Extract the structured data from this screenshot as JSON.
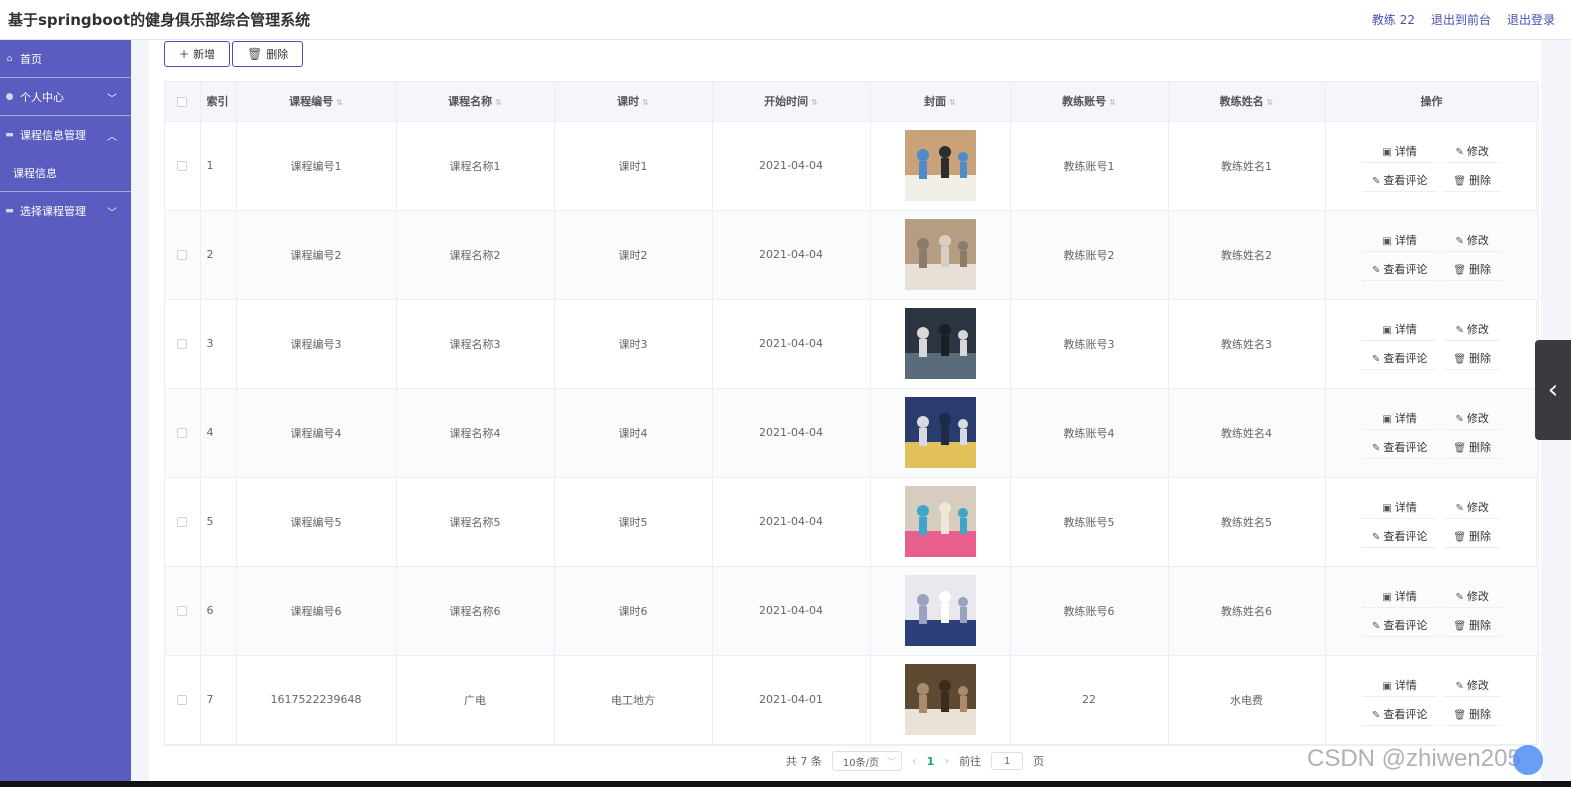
{
  "header": {
    "title": "基于springboot的健身俱乐部综合管理系统",
    "user_label": "教练 22",
    "back_front": "退出到前台",
    "logout": "退出登录"
  },
  "sidebar": {
    "items": [
      {
        "label": "首页",
        "icon": "home-icon",
        "chevron": ""
      },
      {
        "label": "个人中心",
        "icon": "user-icon",
        "chevron": "﹀"
      },
      {
        "label": "课程信息管理",
        "icon": "folder-icon",
        "chevron": "︿"
      },
      {
        "label": "课程信息",
        "icon": "",
        "chevron": ""
      },
      {
        "label": "选择课程管理",
        "icon": "folder-icon",
        "chevron": "﹀"
      }
    ]
  },
  "toolbar": {
    "add_label": "新增",
    "delete_label": "删除"
  },
  "table": {
    "columns": [
      "索引",
      "课程编号",
      "课程名称",
      "课时",
      "开始时间",
      "封面",
      "教练账号",
      "教练姓名",
      "操作"
    ],
    "rows": [
      {
        "index": "1",
        "code": "课程编号1",
        "name": "课程名称1",
        "hours": "课时1",
        "start": "2021-04-04",
        "account": "教练账号1",
        "coach": "教练姓名1"
      },
      {
        "index": "2",
        "code": "课程编号2",
        "name": "课程名称2",
        "hours": "课时2",
        "start": "2021-04-04",
        "account": "教练账号2",
        "coach": "教练姓名2"
      },
      {
        "index": "3",
        "code": "课程编号3",
        "name": "课程名称3",
        "hours": "课时3",
        "start": "2021-04-04",
        "account": "教练账号3",
        "coach": "教练姓名3"
      },
      {
        "index": "4",
        "code": "课程编号4",
        "name": "课程名称4",
        "hours": "课时4",
        "start": "2021-04-04",
        "account": "教练账号4",
        "coach": "教练姓名4"
      },
      {
        "index": "5",
        "code": "课程编号5",
        "name": "课程名称5",
        "hours": "课时5",
        "start": "2021-04-04",
        "account": "教练账号5",
        "coach": "教练姓名5"
      },
      {
        "index": "6",
        "code": "课程编号6",
        "name": "课程名称6",
        "hours": "课时6",
        "start": "2021-04-04",
        "account": "教练账号6",
        "coach": "教练姓名6"
      },
      {
        "index": "7",
        "code": "1617522239648",
        "name": "广电",
        "hours": "电工地方",
        "start": "2021-04-01",
        "account": "22",
        "coach": "水电费"
      }
    ],
    "ops": {
      "detail": "详情",
      "edit": "修改",
      "comments": "查看评论",
      "delete": "删除"
    }
  },
  "pagination": {
    "total": "共 7 条",
    "page_size": "10条/页",
    "current": "1",
    "goto_prefix": "前往",
    "goto_value": "1",
    "goto_suffix": "页"
  },
  "watermark": "CSDN @zhiwen205",
  "colors": {
    "sidebar": "#5a5cc0",
    "accent": "#4a4fb8",
    "page_active": "#1aa37a"
  }
}
